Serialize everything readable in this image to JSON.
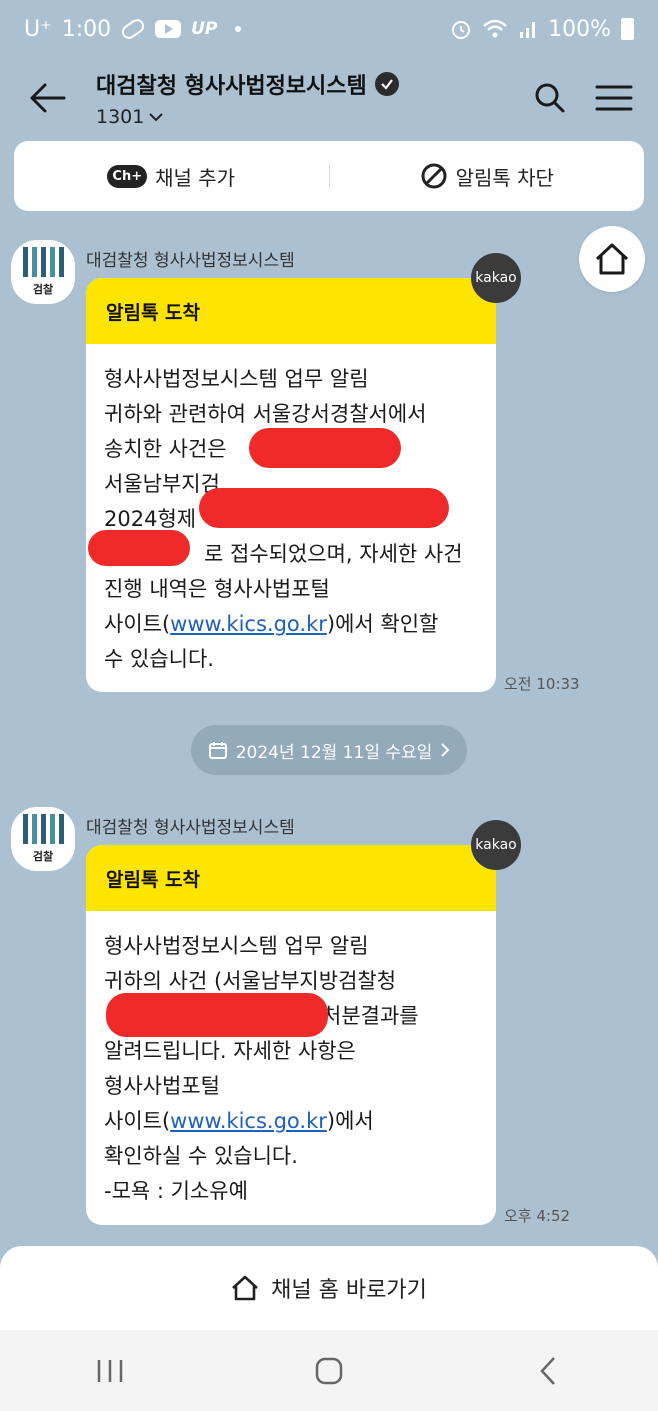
{
  "status": {
    "carrier": "U⁺",
    "time": "1:00",
    "up_label": "UP",
    "battery": "100%"
  },
  "header": {
    "title": "대검찰청 형사사법정보시스템",
    "subtitle": "1301"
  },
  "actions": {
    "add_channel": "채널 추가",
    "block": "알림톡 차단"
  },
  "messages": [
    {
      "sender": "대검찰청 형사사법정보시스템",
      "badge": "kakao",
      "head": "알림톡 도착",
      "lines": [
        "형사사법정보시스템 업무 알림",
        "귀하와 관련하여 서울강서경찰서에서",
        "송치한 사건은",
        "서울남부지검",
        "2024형제",
        "로 접수되었으며, 자세한 사건",
        "진행 내역은 형사사법포털",
        "사이트(",
        "www.kics.go.kr",
        ")에서 확인할",
        "수 있습니다."
      ],
      "time": "오전 10:33"
    },
    {
      "sender": "대검찰청 형사사법정보시스템",
      "badge": "kakao",
      "head": "알림톡 도착",
      "lines": [
        "형사사법정보시스템 업무 알림",
        "귀하의 사건 (서울남부지방검찰청",
        "처분결과를",
        "알려드립니다. 자세한 사항은",
        "형사사법포털",
        "사이트(",
        "www.kics.go.kr",
        ")에서",
        "확인하실 수 있습니다.",
        "-모욕 : 기소유예"
      ],
      "time": "오후 4:52"
    }
  ],
  "avatar_label": "검찰",
  "date_divider": "2024년 12월 11일 수요일",
  "channel_home": "채널 홈 바로가기",
  "colors": {
    "background": "#abc1d1",
    "bubble_header": "#fee500",
    "link": "#1f5fbf",
    "redaction": "#f0292a"
  }
}
